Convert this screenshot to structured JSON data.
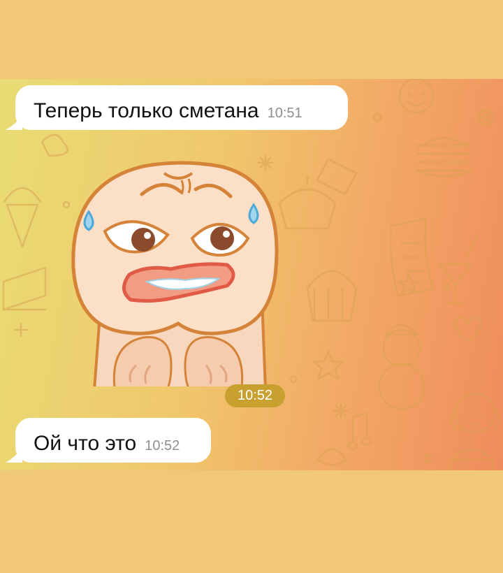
{
  "messages": [
    {
      "text": "Теперь только сметана",
      "time": "10:51"
    },
    {
      "sticker_time": "10:52"
    },
    {
      "text": "Ой что это",
      "time": "10:52"
    }
  ],
  "sticker_icon": "sweating-worried-character-sticker",
  "colors": {
    "bubble": "#FFFFFF",
    "time_text": "#8E8E93",
    "sticker_time_badge": "#C8A030",
    "page_background": "#F0C878"
  }
}
